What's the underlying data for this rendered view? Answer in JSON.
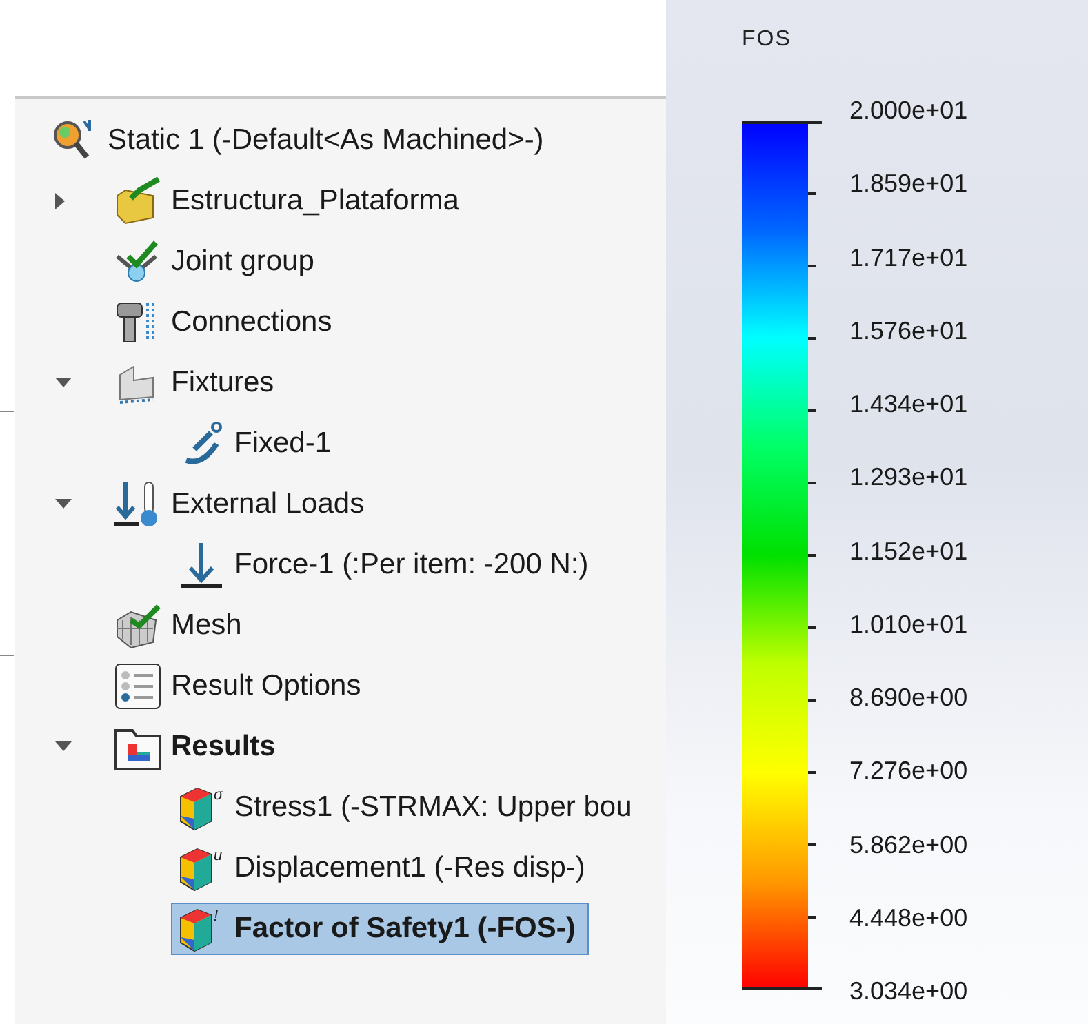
{
  "tree": [
    {
      "label": "Static 1 (-Default<As Machined>-)",
      "kind": "study",
      "selected": false,
      "children": [
        {
          "label": "Estructura_Plataforma",
          "kind": "part",
          "expanded": false,
          "selected": false
        },
        {
          "label": "Joint group",
          "kind": "joint",
          "selected": false
        },
        {
          "label": "Connections",
          "kind": "connections",
          "selected": false
        },
        {
          "label": "Fixtures",
          "kind": "fixtures",
          "expanded": true,
          "selected": false,
          "children": [
            {
              "label": "Fixed-1",
              "kind": "anchor",
              "selected": false
            }
          ]
        },
        {
          "label": "External Loads",
          "kind": "loads",
          "expanded": true,
          "selected": false,
          "children": [
            {
              "label": "Force-1 (:Per item: -200 N:)",
              "kind": "force",
              "selected": false
            }
          ]
        },
        {
          "label": "Mesh",
          "kind": "mesh",
          "selected": false
        },
        {
          "label": "Result Options",
          "kind": "options",
          "selected": false
        },
        {
          "label": "Results",
          "kind": "results",
          "expanded": true,
          "bold": true,
          "selected": false,
          "children": [
            {
              "label": "Stress1 (-STRMAX: Upper bou",
              "kind": "plot",
              "symbol": "σ",
              "selected": false
            },
            {
              "label": "Displacement1 (-Res disp-)",
              "kind": "plot",
              "symbol": "u",
              "selected": false
            },
            {
              "label": "Factor of Safety1 (-FOS-)",
              "kind": "plot",
              "symbol": "!",
              "selected": true
            }
          ]
        }
      ]
    }
  ],
  "legend": {
    "title": "FOS",
    "labels": [
      "2.000e+01",
      "1.859e+01",
      "1.717e+01",
      "1.576e+01",
      "1.434e+01",
      "1.293e+01",
      "1.152e+01",
      "1.010e+01",
      "8.690e+00",
      "7.276e+00",
      "5.862e+00",
      "4.448e+00",
      "3.034e+00"
    ]
  }
}
